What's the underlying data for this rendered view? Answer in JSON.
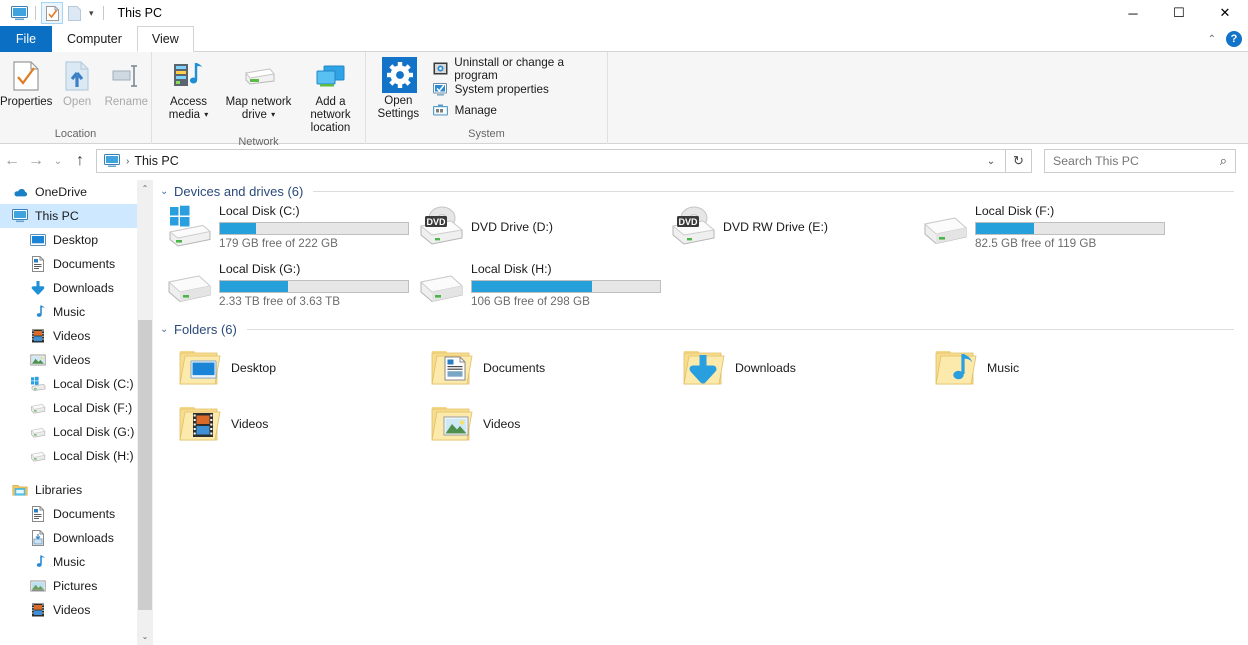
{
  "window": {
    "title": "This PC",
    "minimize_label": "─",
    "maximize_label": "☐",
    "close_label": "✕",
    "collapse_ribbon_label": "⌃",
    "help_label": "?"
  },
  "quick_access": {
    "items": [
      {
        "name": "this-pc-icon",
        "label": ""
      },
      {
        "name": "properties-icon",
        "label": ""
      },
      {
        "name": "new-folder-icon",
        "label": ""
      },
      {
        "name": "customize-qat-caret",
        "label": "▾"
      }
    ]
  },
  "tabs": [
    {
      "label": "File",
      "state": "file"
    },
    {
      "label": "Computer",
      "state": "inactive"
    },
    {
      "label": "View",
      "state": "active"
    }
  ],
  "ribbon": {
    "groups": [
      {
        "label": "Location",
        "buttons": [
          {
            "label": "Properties",
            "icon": "properties-icon",
            "disabled": false
          },
          {
            "label": "Open",
            "icon": "open-icon",
            "disabled": true
          },
          {
            "label": "Rename",
            "icon": "rename-icon",
            "disabled": true
          }
        ]
      },
      {
        "label": "Network",
        "buttons": [
          {
            "label": "Access media",
            "icon": "access-media-icon",
            "dropdown": true,
            "disabled": false
          },
          {
            "label": "Map network drive",
            "icon": "map-network-drive-icon",
            "dropdown": true,
            "disabled": false
          },
          {
            "label": "Add a network location",
            "icon": "add-network-location-icon",
            "dropdown": false,
            "disabled": false
          }
        ]
      },
      {
        "label": "System",
        "big_button": {
          "label": "Open Settings",
          "icon": "gear-icon"
        },
        "small_buttons": [
          {
            "label": "Uninstall or change a program",
            "icon": "uninstall-program-icon"
          },
          {
            "label": "System properties",
            "icon": "system-properties-icon"
          },
          {
            "label": "Manage",
            "icon": "manage-icon"
          }
        ]
      }
    ]
  },
  "addressbar": {
    "back_label": "←",
    "forward_label": "→",
    "recent_label": "⌄",
    "up_label": "↑",
    "breadcrumb_icon": "this-pc-icon",
    "breadcrumb_sep": "›",
    "breadcrumb_text": "This PC",
    "dropdown_label": "⌄",
    "refresh_label": "↻"
  },
  "search": {
    "placeholder": "Search This PC",
    "icon_label": "⌕"
  },
  "sidebar": {
    "items": [
      {
        "label": "OneDrive",
        "icon": "onedrive-icon",
        "indent": 0,
        "selected": false
      },
      {
        "label": "This PC",
        "icon": "this-pc-icon",
        "indent": 0,
        "selected": true
      },
      {
        "label": "Desktop",
        "icon": "desktop-icon",
        "indent": 1,
        "selected": false
      },
      {
        "label": "Documents",
        "icon": "documents-icon",
        "indent": 1,
        "selected": false
      },
      {
        "label": "Downloads",
        "icon": "downloads-icon",
        "indent": 1,
        "selected": false
      },
      {
        "label": "Music",
        "icon": "music-icon",
        "indent": 1,
        "selected": false
      },
      {
        "label": "Videos",
        "icon": "videos-film-icon",
        "indent": 1,
        "selected": false
      },
      {
        "label": "Videos",
        "icon": "videos-picture-icon",
        "indent": 1,
        "selected": false
      },
      {
        "label": "Local Disk (C:)",
        "icon": "windows-drive-icon",
        "indent": 1,
        "selected": false
      },
      {
        "label": "Local Disk (F:)",
        "icon": "drive-icon",
        "indent": 1,
        "selected": false
      },
      {
        "label": "Local Disk (G:)",
        "icon": "drive-icon",
        "indent": 1,
        "selected": false
      },
      {
        "label": "Local Disk (H:)",
        "icon": "drive-icon",
        "indent": 1,
        "selected": false
      },
      {
        "label": "Libraries",
        "icon": "libraries-icon",
        "indent": 0,
        "selected": false
      },
      {
        "label": "Documents",
        "icon": "documents-icon",
        "indent": 1,
        "selected": false
      },
      {
        "label": "Downloads",
        "icon": "downloads-library-icon",
        "indent": 1,
        "selected": false
      },
      {
        "label": "Music",
        "icon": "music-icon",
        "indent": 1,
        "selected": false
      },
      {
        "label": "Pictures",
        "icon": "pictures-icon",
        "indent": 1,
        "selected": false
      },
      {
        "label": "Videos",
        "icon": "videos-film-icon",
        "indent": 1,
        "selected": false
      }
    ],
    "scrollbar": {
      "up_arrow": "⌃",
      "down_arrow": "⌄"
    }
  },
  "content": {
    "groups": [
      {
        "header": "Devices and drives (6)",
        "chevron": "⌄",
        "kind": "drives",
        "items": [
          {
            "name": "Local Disk (C:)",
            "icon": "windows-drive-icon",
            "has_bar": true,
            "fill_percent": 19,
            "free_text": "179 GB free of 222 GB"
          },
          {
            "name": "DVD Drive (D:)",
            "icon": "dvd-drive-icon",
            "has_bar": false,
            "fill_percent": 0,
            "free_text": ""
          },
          {
            "name": "DVD RW Drive (E:)",
            "icon": "dvd-drive-icon",
            "has_bar": false,
            "fill_percent": 0,
            "free_text": ""
          },
          {
            "name": "Local Disk (F:)",
            "icon": "drive-icon",
            "has_bar": true,
            "fill_percent": 31,
            "free_text": "82.5 GB free of 119 GB"
          },
          {
            "name": "Local Disk (G:)",
            "icon": "drive-icon",
            "has_bar": true,
            "fill_percent": 36,
            "free_text": "2.33 TB free of 3.63 TB"
          },
          {
            "name": "Local Disk (H:)",
            "icon": "drive-icon",
            "has_bar": true,
            "fill_percent": 64,
            "free_text": "106 GB free of 298 GB"
          }
        ]
      },
      {
        "header": "Folders (6)",
        "chevron": "⌄",
        "kind": "folders",
        "items": [
          {
            "name": "Desktop",
            "icon": "folder-desktop-icon"
          },
          {
            "name": "Documents",
            "icon": "folder-documents-icon"
          },
          {
            "name": "Downloads",
            "icon": "folder-downloads-icon"
          },
          {
            "name": "Music",
            "icon": "folder-music-icon"
          },
          {
            "name": "Videos",
            "icon": "folder-videos-film-icon"
          },
          {
            "name": "Videos",
            "icon": "folder-videos-picture-icon"
          }
        ]
      }
    ]
  },
  "colors": {
    "accent_blue": "#0b6fc4",
    "progress_blue": "#26a0da",
    "selection_blue": "#cde8ff",
    "group_header_blue": "#2a4a7a"
  }
}
